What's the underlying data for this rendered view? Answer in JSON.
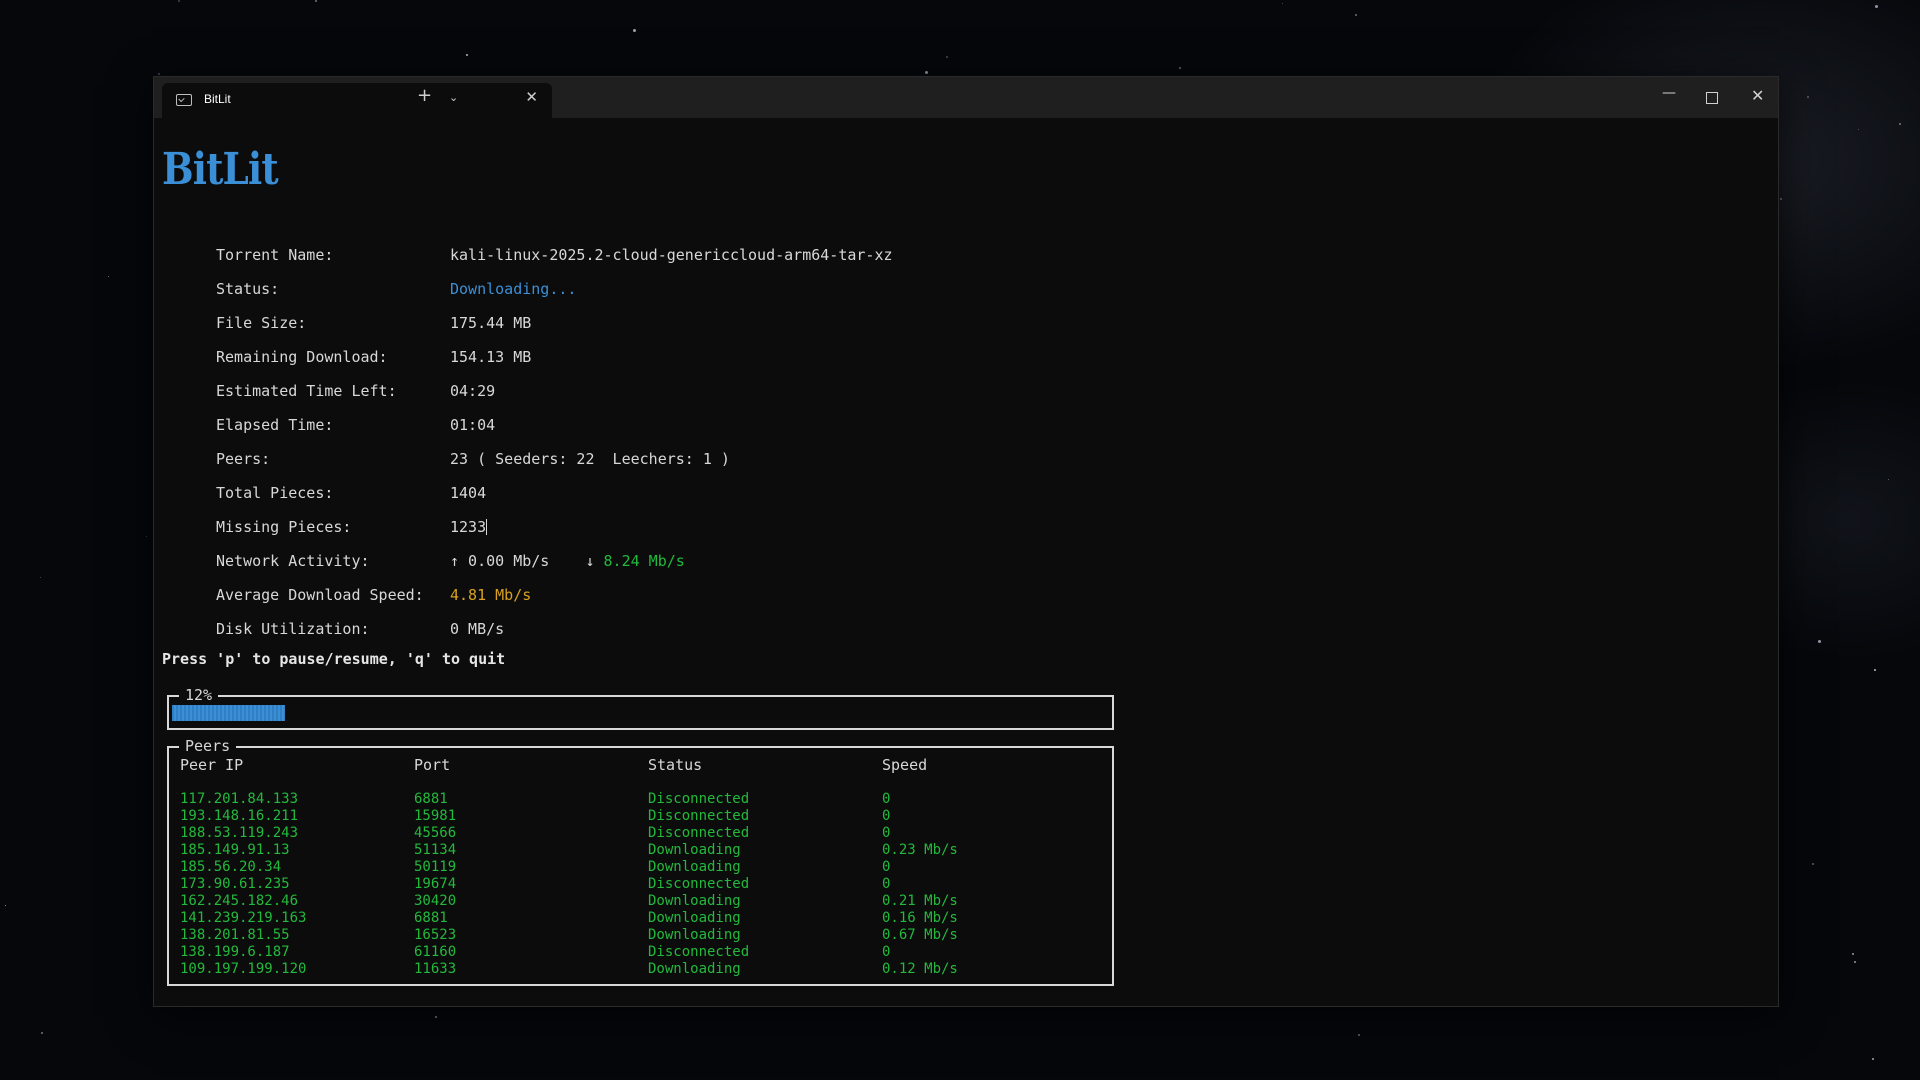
{
  "window": {
    "tab_title": "BitLit",
    "new_tab_glyph": "+",
    "dropdown_glyph": "⌄",
    "close_tab_glyph": "✕",
    "minimize_glyph": "—",
    "close_glyph": "✕"
  },
  "app": {
    "logo": "BitLit",
    "info": [
      {
        "label": "Torrent Name:",
        "value": "kali-linux-2025.2-cloud-genericcloud-arm64-tar-xz"
      },
      {
        "label": "Status:",
        "value": "Downloading..."
      },
      {
        "label": "File Size:",
        "value": "175.44 MB"
      },
      {
        "label": "Remaining Download:",
        "value": "154.13 MB"
      },
      {
        "label": "Estimated Time Left:",
        "value": "04:29"
      },
      {
        "label": "Elapsed Time:",
        "value": "01:04"
      },
      {
        "label": "Peers:",
        "value": "23 ( Seeders: 22  Leechers: 1 )"
      },
      {
        "label": "Total Pieces:",
        "value": "1404"
      },
      {
        "label": "Missing Pieces:",
        "value": "1233"
      },
      {
        "label": "Network Activity:",
        "upload": "↑ 0.00 Mb/s",
        "download_arrow": "↓",
        "download": "8.24 Mb/s"
      },
      {
        "label": "Average Download Speed:",
        "value": "4.81 Mb/s"
      },
      {
        "label": "Disk Utilization:",
        "value": "0 MB/s"
      }
    ],
    "hint": "Press 'p' to pause/resume, 'q' to quit",
    "progress": {
      "label": "12%",
      "fraction": 0.12
    },
    "peers": {
      "title": "Peers",
      "headers": [
        "Peer IP",
        "Port",
        "Status",
        "Speed"
      ],
      "rows": [
        [
          "117.201.84.133",
          "6881",
          "Disconnected",
          "0"
        ],
        [
          "193.148.16.211",
          "15981",
          "Disconnected",
          "0"
        ],
        [
          "188.53.119.243",
          "45566",
          "Disconnected",
          "0"
        ],
        [
          "185.149.91.13",
          "51134",
          "Downloading",
          "0.23 Mb/s"
        ],
        [
          "185.56.20.34",
          "50119",
          "Downloading",
          "0"
        ],
        [
          "173.90.61.235",
          "19674",
          "Disconnected",
          "0"
        ],
        [
          "162.245.182.46",
          "30420",
          "Downloading",
          "0.21 Mb/s"
        ],
        [
          "141.239.219.163",
          "6881",
          "Downloading",
          "0.16 Mb/s"
        ],
        [
          "138.201.81.55",
          "16523",
          "Downloading",
          "0.67 Mb/s"
        ],
        [
          "138.199.6.187",
          "61160",
          "Disconnected",
          "0"
        ],
        [
          "109.197.199.120",
          "11633",
          "Downloading",
          "0.12 Mb/s"
        ]
      ]
    }
  },
  "colors": {
    "accent_blue": "#3b8fd6",
    "green": "#23b93c",
    "orange": "#d9a21e",
    "background": "#0c0c0c"
  }
}
